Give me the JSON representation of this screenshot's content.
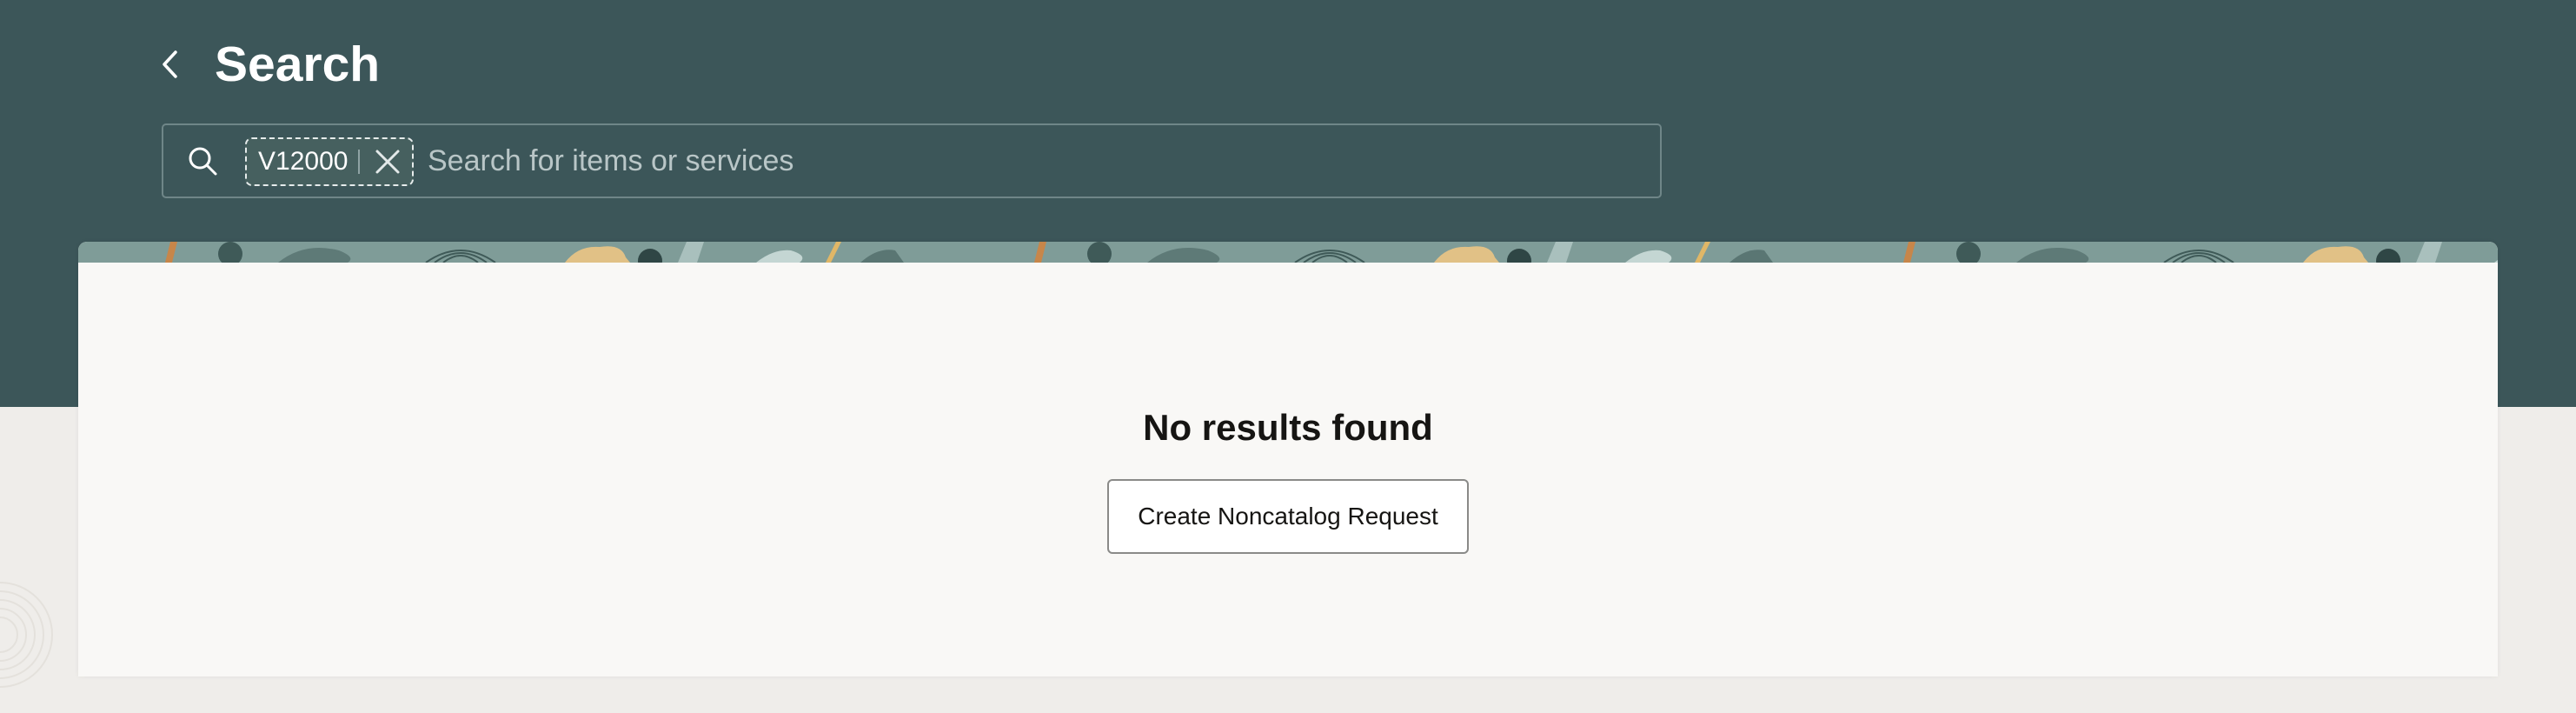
{
  "header": {
    "title": "Search",
    "back_icon": "chevron-left-icon",
    "background_color": "#3c5659"
  },
  "search": {
    "icon": "search-icon",
    "chips": [
      {
        "label": "V12000",
        "remove_icon": "close-icon"
      }
    ],
    "value": "",
    "placeholder": "Search for items or services"
  },
  "results": {
    "empty_title": "No results found",
    "create_button_label": "Create Noncatalog Request"
  }
}
